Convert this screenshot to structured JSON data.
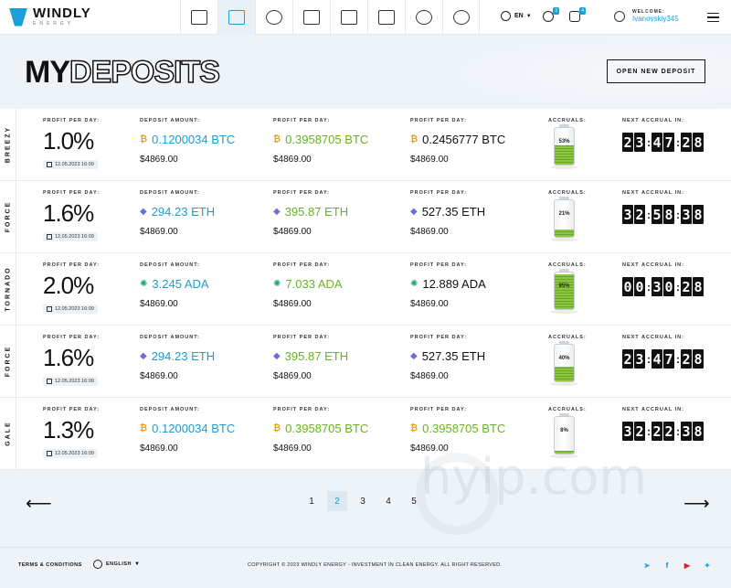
{
  "brand": {
    "name": "WINDLY",
    "sub": "ENERGY"
  },
  "header": {
    "lang": "EN",
    "support_badge": "3",
    "notes_badge": "4",
    "welcome": "WELCOME:",
    "username": "Ivanovskiy345"
  },
  "page": {
    "title_part1": "MY",
    "title_part2": "DEPOSITS",
    "open_button": "OPEN NEW DEPOSIT"
  },
  "labels": {
    "profit_per_day": "PROFIT PER DAY:",
    "deposit_amount": "DEPOSIT AMOUNT:",
    "accruals": "ACCRUALS:",
    "next_accrual": "NEXT ACCRUAL IN:"
  },
  "deposits": [
    {
      "plan": "BREEZY",
      "percent": "1.0%",
      "date": "12.05.2023  16:09",
      "coin": "btc",
      "deposit": "0.1200034 BTC",
      "deposit_usd": "$4869.00",
      "profit": "0.3958705 BTC",
      "profit_usd": "$4869.00",
      "profit2": "0.2456777 BTC",
      "profit2_usd": "$4869.00",
      "profit2_color": "black",
      "accrual": "53%",
      "accrual_value": 0.53,
      "timer": [
        "2",
        "3",
        "4",
        "7",
        "2",
        "8"
      ]
    },
    {
      "plan": "FORCE",
      "percent": "1.6%",
      "date": "12.05.2023  16:09",
      "coin": "eth",
      "deposit": "294.23 ETH",
      "deposit_usd": "$4869.00",
      "profit": "395.87 ETH",
      "profit_usd": "$4869.00",
      "profit2": "527.35 ETH",
      "profit2_usd": "$4869.00",
      "profit2_color": "black",
      "accrual": "21%",
      "accrual_value": 0.21,
      "timer": [
        "3",
        "2",
        "5",
        "8",
        "3",
        "8"
      ]
    },
    {
      "plan": "TORNADO",
      "percent": "2.0%",
      "date": "12.05.2023  16:09",
      "coin": "ada",
      "deposit": "3.245 ADA",
      "deposit_usd": "$4869.00",
      "profit": "7.033 ADA",
      "profit_usd": "$4869.00",
      "profit2": "12.889 ADA",
      "profit2_usd": "$4869.00",
      "profit2_color": "black",
      "accrual": "95%",
      "accrual_value": 0.95,
      "timer": [
        "0",
        "0",
        "3",
        "0",
        "2",
        "8"
      ]
    },
    {
      "plan": "FORCE",
      "percent": "1.6%",
      "date": "12.05.2023  16:09",
      "coin": "eth",
      "deposit": "294.23 ETH",
      "deposit_usd": "$4869.00",
      "profit": "395.87 ETH",
      "profit_usd": "$4869.00",
      "profit2": "527.35 ETH",
      "profit2_usd": "$4869.00",
      "profit2_color": "black",
      "accrual": "40%",
      "accrual_value": 0.4,
      "timer": [
        "2",
        "3",
        "4",
        "7",
        "2",
        "8"
      ]
    },
    {
      "plan": "GALE",
      "percent": "1.3%",
      "date": "12.05.2023  16:09",
      "coin": "btc",
      "deposit": "0.1200034 BTC",
      "deposit_usd": "$4869.00",
      "profit": "0.3958705 BTC",
      "profit_usd": "$4869.00",
      "profit2": "0.3958705 BTC",
      "profit2_usd": "$4869.00",
      "profit2_color": "green",
      "accrual": "8%",
      "accrual_value": 0.08,
      "timer": [
        "3",
        "2",
        "2",
        "2",
        "3",
        "8"
      ]
    }
  ],
  "coin_glyphs": {
    "btc": "₿",
    "eth": "◆",
    "ada": "✺"
  },
  "pagination": {
    "pages": [
      "1",
      "2",
      "3",
      "4",
      "5"
    ],
    "active": "2",
    "prev": "⟵",
    "next": "⟶"
  },
  "watermark": "hyip.com",
  "footer": {
    "terms": "TERMS & CONDITIONS",
    "language": "ENGLISH",
    "copyright": "COPYRIGHT © 2023 WINDLY ENERGY - INVESTMENT IN CLEAN ENERGY.  ALL RIGHT RESERVED.",
    "socials": [
      {
        "name": "telegram-icon",
        "glyph": "➤",
        "color": "#2aa3d8"
      },
      {
        "name": "facebook-icon",
        "glyph": "f",
        "color": "#1877f2"
      },
      {
        "name": "youtube-icon",
        "glyph": "▶",
        "color": "#e02020"
      },
      {
        "name": "twitter-icon",
        "glyph": "✦",
        "color": "#1da1f2"
      }
    ]
  },
  "colors": {
    "accent": "#1a9cd6",
    "green": "#68b31e",
    "battery": "#8cc63f"
  }
}
